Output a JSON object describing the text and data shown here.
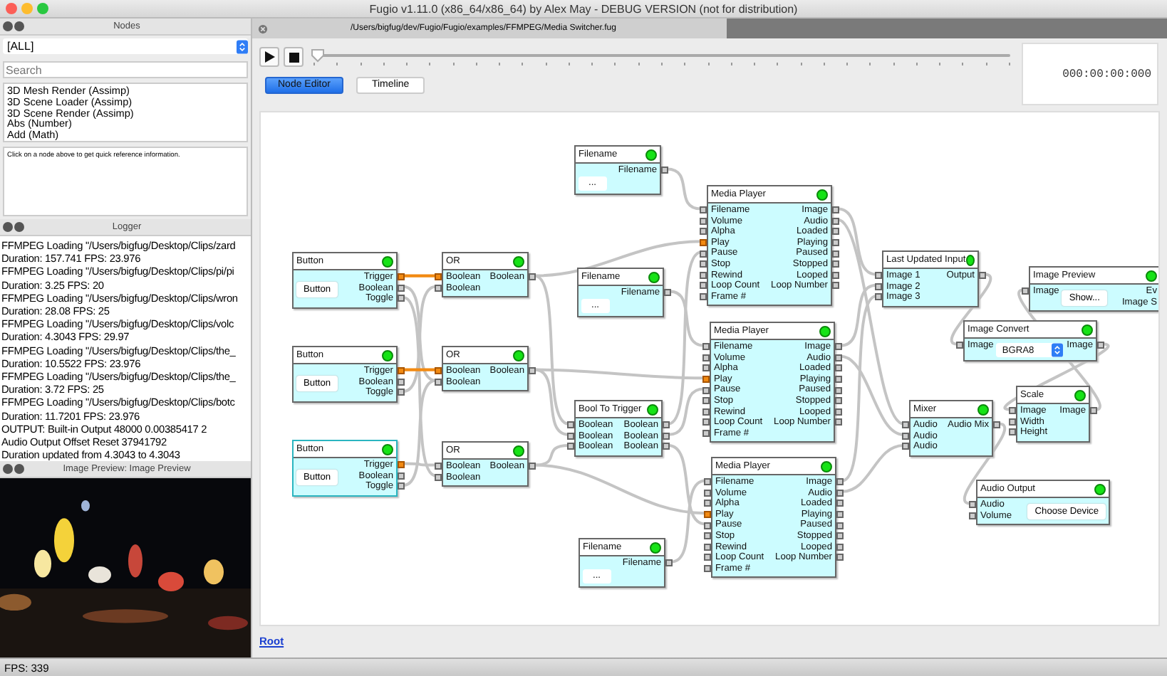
{
  "window": {
    "title": "Fugio v1.11.0 (x86_64/x86_64) by Alex May - DEBUG VERSION (not for distribution)"
  },
  "nodes_panel": {
    "title": "Nodes",
    "category": "[ALL]",
    "search": {
      "placeholder": "Search"
    },
    "items": [
      "3D Mesh Render (Assimp)",
      "3D Scene Loader (Assimp)",
      "3D Scene Render (Assimp)",
      "Abs (Number)",
      "Add (Math)"
    ],
    "info": "Click on a node above to get quick reference information."
  },
  "logger": {
    "title": "Logger",
    "lines": [
      "FFMPEG Loading \"/Users/bigfug/Desktop/Clips/zard",
      "Duration: 157.741 FPS: 23.976",
      "FFMPEG Loading \"/Users/bigfug/Desktop/Clips/pi/pi",
      "Duration: 3.25 FPS: 20",
      "FFMPEG Loading \"/Users/bigfug/Desktop/Clips/wron",
      "Duration: 28.08 FPS: 25",
      "FFMPEG Loading \"/Users/bigfug/Desktop/Clips/volc",
      "Duration: 4.3043 FPS: 29.97",
      "FFMPEG Loading \"/Users/bigfug/Desktop/Clips/the_",
      "Duration: 10.5522 FPS: 23.976",
      "FFMPEG Loading \"/Users/bigfug/Desktop/Clips/the_",
      "Duration: 3.72 FPS: 25",
      "FFMPEG Loading \"/Users/bigfug/Desktop/Clips/botc",
      "Duration: 11.7201 FPS: 23.976",
      "OUTPUT: Built-in Output 48000 0.00385417 2",
      "Audio Output Offset Reset 37941792",
      "Duration updated from 4.3043 to 4.3043"
    ]
  },
  "preview_panel": {
    "title": "Image Preview: Image Preview",
    "kind": "picture"
  },
  "status_bar": {
    "fps": "FPS: 339"
  },
  "editor": {
    "tab": "/Users/bigfug/dev/Fugio/Fugio/examples/FFMPEG/Media Switcher.fug",
    "timeline_slider": {
      "level": 0
    },
    "timecode": "000:00:00:000",
    "views": [
      {
        "label": "Node Editor",
        "selected": true
      },
      {
        "label": "Timeline",
        "selected": false
      }
    ],
    "nodes": [
      {
        "title": "Filename",
        "selected": false,
        "widget": {
          "kind": "field",
          "label": "..."
        },
        "outputs": [
          {
            "label": "Filename",
            "active": false
          }
        ]
      },
      {
        "title": "Media Player",
        "selected": false,
        "inputs": [
          {
            "label": "Filename",
            "active": false
          },
          {
            "label": "Volume",
            "active": false
          },
          {
            "label": "Alpha",
            "active": false
          },
          {
            "label": "Play",
            "active": true
          },
          {
            "label": "Pause",
            "active": false
          },
          {
            "label": "Stop",
            "active": false
          },
          {
            "label": "Rewind",
            "active": false
          },
          {
            "label": "Loop Count",
            "active": false
          },
          {
            "label": "Frame #",
            "active": false
          }
        ],
        "outputs": [
          {
            "label": "Image",
            "active": false
          },
          {
            "label": "Audio",
            "active": false
          },
          {
            "label": "Loaded",
            "active": false
          },
          {
            "label": "Playing",
            "active": false
          },
          {
            "label": "Paused",
            "active": false
          },
          {
            "label": "Stopped",
            "active": false
          },
          {
            "label": "Looped",
            "active": false
          },
          {
            "label": "Loop Number",
            "active": false
          }
        ]
      },
      {
        "title": "Filename",
        "selected": false,
        "widget": {
          "kind": "field",
          "label": "..."
        },
        "outputs": [
          {
            "label": "Filename",
            "active": false
          }
        ]
      },
      {
        "title": "Button",
        "selected": false,
        "widget": {
          "kind": "button",
          "label": "Button"
        },
        "outputs": [
          {
            "label": "Trigger",
            "active": true
          },
          {
            "label": "Boolean",
            "active": false
          },
          {
            "label": "Toggle",
            "active": false
          }
        ]
      },
      {
        "title": "OR",
        "selected": false,
        "inputs": [
          {
            "label": "Boolean",
            "active": true
          },
          {
            "label": "Boolean",
            "active": false
          }
        ],
        "outputs": [
          {
            "label": "Boolean",
            "active": false
          }
        ]
      },
      {
        "title": "Button",
        "selected": false,
        "widget": {
          "kind": "button",
          "label": "Button"
        },
        "outputs": [
          {
            "label": "Trigger",
            "active": true
          },
          {
            "label": "Boolean",
            "active": false
          },
          {
            "label": "Toggle",
            "active": false
          }
        ]
      },
      {
        "title": "OR",
        "selected": false,
        "inputs": [
          {
            "label": "Boolean",
            "active": true
          },
          {
            "label": "Boolean",
            "active": false
          }
        ],
        "outputs": [
          {
            "label": "Boolean",
            "active": false
          }
        ]
      },
      {
        "title": "Button",
        "selected": true,
        "widget": {
          "kind": "button",
          "label": "Button"
        },
        "outputs": [
          {
            "label": "Trigger",
            "active": true
          },
          {
            "label": "Boolean",
            "active": false
          },
          {
            "label": "Toggle",
            "active": false
          }
        ]
      },
      {
        "title": "OR",
        "selected": false,
        "inputs": [
          {
            "label": "Boolean",
            "active": false
          },
          {
            "label": "Boolean",
            "active": false
          }
        ],
        "outputs": [
          {
            "label": "Boolean",
            "active": false
          }
        ]
      },
      {
        "title": "Bool To Trigger",
        "selected": false,
        "inputs": [
          {
            "label": "Boolean",
            "active": false
          },
          {
            "label": "Boolean",
            "active": false
          },
          {
            "label": "Boolean",
            "active": false
          }
        ],
        "outputs": [
          {
            "label": "Boolean",
            "active": false
          },
          {
            "label": "Boolean",
            "active": false
          },
          {
            "label": "Boolean",
            "active": false
          }
        ]
      },
      {
        "title": "Media Player",
        "selected": false,
        "inputs": [
          {
            "label": "Filename",
            "active": false
          },
          {
            "label": "Volume",
            "active": false
          },
          {
            "label": "Alpha",
            "active": false
          },
          {
            "label": "Play",
            "active": true
          },
          {
            "label": "Pause",
            "active": false
          },
          {
            "label": "Stop",
            "active": false
          },
          {
            "label": "Rewind",
            "active": false
          },
          {
            "label": "Loop Count",
            "active": false
          },
          {
            "label": "Frame #",
            "active": false
          }
        ],
        "outputs": [
          {
            "label": "Image",
            "active": false
          },
          {
            "label": "Audio",
            "active": false
          },
          {
            "label": "Loaded",
            "active": false
          },
          {
            "label": "Playing",
            "active": false
          },
          {
            "label": "Paused",
            "active": false
          },
          {
            "label": "Stopped",
            "active": false
          },
          {
            "label": "Looped",
            "active": false
          },
          {
            "label": "Loop Number",
            "active": false
          }
        ]
      },
      {
        "title": "Media Player",
        "selected": false,
        "inputs": [
          {
            "label": "Filename",
            "active": false
          },
          {
            "label": "Volume",
            "active": false
          },
          {
            "label": "Alpha",
            "active": false
          },
          {
            "label": "Play",
            "active": true
          },
          {
            "label": "Pause",
            "active": false
          },
          {
            "label": "Stop",
            "active": false
          },
          {
            "label": "Rewind",
            "active": false
          },
          {
            "label": "Loop Count",
            "active": false
          },
          {
            "label": "Frame #",
            "active": false
          }
        ],
        "outputs": [
          {
            "label": "Image",
            "active": false
          },
          {
            "label": "Audio",
            "active": false
          },
          {
            "label": "Loaded",
            "active": false
          },
          {
            "label": "Playing",
            "active": false
          },
          {
            "label": "Paused",
            "active": false
          },
          {
            "label": "Stopped",
            "active": false
          },
          {
            "label": "Looped",
            "active": false
          },
          {
            "label": "Loop Number",
            "active": false
          }
        ]
      },
      {
        "title": "Filename",
        "selected": false,
        "widget": {
          "kind": "field",
          "label": "..."
        },
        "outputs": [
          {
            "label": "Filename",
            "active": false
          }
        ]
      },
      {
        "title": "Last Updated Input",
        "selected": false,
        "inputs": [
          {
            "label": "Image 1",
            "active": false
          },
          {
            "label": "Image 2",
            "active": false
          },
          {
            "label": "Image 3",
            "active": false
          }
        ],
        "outputs": [
          {
            "label": "Output",
            "active": false
          }
        ]
      },
      {
        "title": "Image Preview",
        "selected": false,
        "inputs": [
          {
            "label": "Image",
            "active": false
          }
        ],
        "widget": {
          "kind": "button",
          "label": "Show..."
        },
        "outputs": [
          {
            "label": "Ev"
          },
          {
            "label": "Image S"
          }
        ]
      },
      {
        "title": "Image Convert",
        "selected": false,
        "inputs": [
          {
            "label": "Image",
            "active": false
          }
        ],
        "widget": {
          "kind": "select",
          "label": "BGRA8"
        },
        "outputs": [
          {
            "label": "Image",
            "active": false
          }
        ]
      },
      {
        "title": "Mixer",
        "selected": false,
        "inputs": [
          {
            "label": "Audio",
            "active": false
          },
          {
            "label": "Audio",
            "active": false
          },
          {
            "label": "Audio",
            "active": false
          }
        ],
        "outputs": [
          {
            "label": "Audio Mix",
            "active": false
          }
        ]
      },
      {
        "title": "Scale",
        "selected": false,
        "inputs": [
          {
            "label": "Image",
            "active": false
          },
          {
            "label": "Width",
            "active": false
          },
          {
            "label": "Height",
            "active": false
          }
        ],
        "outputs": [
          {
            "label": "Image",
            "active": false
          }
        ]
      },
      {
        "title": "Audio Output",
        "selected": false,
        "inputs": [
          {
            "label": "Audio",
            "active": false
          },
          {
            "label": "Volume",
            "active": false
          }
        ],
        "widget": {
          "kind": "button",
          "label": "Choose Device"
        }
      }
    ],
    "breadcrumb": "Root"
  }
}
